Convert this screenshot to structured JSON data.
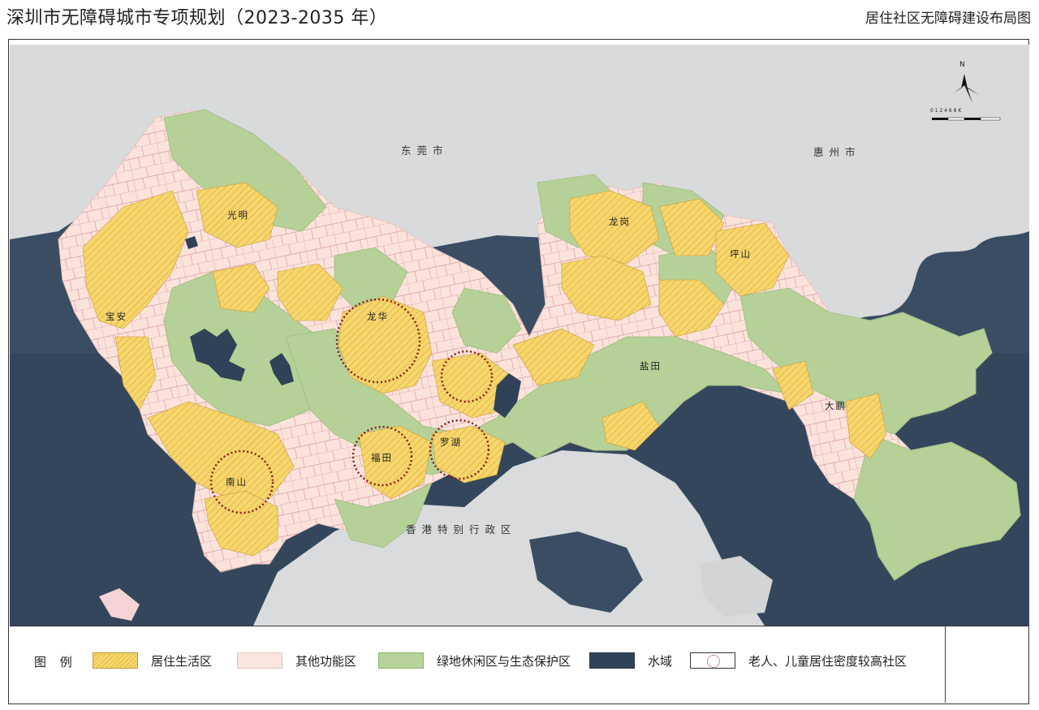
{
  "header": {
    "title": "深圳市无障碍城市专项规划（2023-2035 年）",
    "subtitle": "居住社区无障碍建设布局图"
  },
  "map": {
    "regions_outside": [
      "东莞市",
      "惠州市",
      "香港特别行政区"
    ],
    "districts": [
      "光明",
      "宝安",
      "龙华",
      "龙岗",
      "坪山",
      "盐田",
      "大鹏",
      "福田",
      "罗湖",
      "南山"
    ],
    "compass_label": "N",
    "scale_label": "0  1  2  4  6  8  K",
    "colors": {
      "sea": "#33465c",
      "outside_land": "#d6d8d9",
      "residential": "#f5d46a",
      "other_function": "#fbe3dc",
      "green": "#b6d197",
      "water": "#2f4257",
      "circle": "#8b1a1a"
    },
    "highlighted_communities": [
      "龙华",
      "福田",
      "罗湖",
      "南山",
      "龙华-东"
    ]
  },
  "legend": {
    "title": "图 例",
    "items": [
      {
        "label": "居住生活区",
        "swatch": "residential-hatch"
      },
      {
        "label": "其他功能区",
        "swatch": "other-function"
      },
      {
        "label": "绿地休闲区与生态保护区",
        "swatch": "green"
      },
      {
        "label": "水域",
        "swatch": "water"
      },
      {
        "label": "老人、儿童居住密度较高社区",
        "swatch": "dotted-circle"
      }
    ]
  }
}
